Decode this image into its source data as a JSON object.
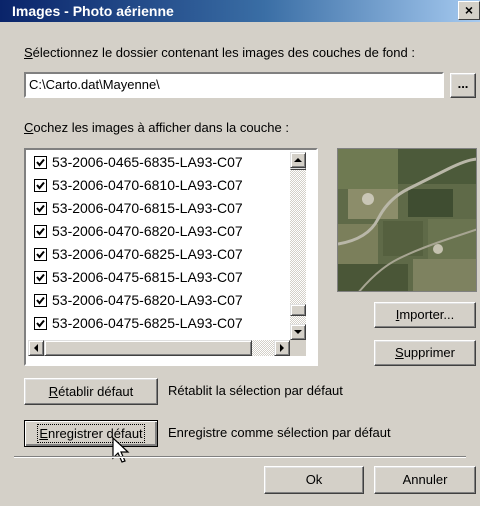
{
  "window": {
    "title": "Images - Photo aérienne",
    "close_glyph": "×"
  },
  "folder": {
    "label_prefix": "S",
    "label_rest": "électionnez le dossier contenant les images des couches de fond :",
    "path_value": "C:\\Carto.dat\\Mayenne\\",
    "browse_label": "..."
  },
  "images": {
    "label_prefix": "C",
    "label_rest": "ochez les images à afficher dans la couche :",
    "items": [
      {
        "name": "53-2006-0465-6835-LA93-C07",
        "checked": true
      },
      {
        "name": "53-2006-0470-6810-LA93-C07",
        "checked": true
      },
      {
        "name": "53-2006-0470-6815-LA93-C07",
        "checked": true
      },
      {
        "name": "53-2006-0470-6820-LA93-C07",
        "checked": true
      },
      {
        "name": "53-2006-0470-6825-LA93-C07",
        "checked": true
      },
      {
        "name": "53-2006-0475-6815-LA93-C07",
        "checked": true
      },
      {
        "name": "53-2006-0475-6820-LA93-C07",
        "checked": true
      },
      {
        "name": "53-2006-0475-6825-LA93-C07",
        "checked": true
      }
    ]
  },
  "buttons": {
    "import_prefix": "I",
    "import_rest": "mporter...",
    "delete_prefix": "S",
    "delete_rest": "upprimer",
    "reset_prefix": "R",
    "reset_rest": "établir défaut",
    "reset_desc": "Rétablit la sélection par défaut",
    "save_prefix": "E",
    "save_rest": "nregistrer défaut",
    "save_desc": "Enregistre comme sélection par défaut",
    "ok_label": "Ok",
    "cancel_label": "Annuler"
  },
  "icons": {
    "checkbox": "checkmark-icon",
    "scroll_up": "arrow-up-icon",
    "scroll_down": "arrow-down-icon",
    "scroll_left": "arrow-left-icon",
    "scroll_right": "arrow-right-icon",
    "cursor": "mouse-pointer-icon"
  },
  "colors": {
    "title_start": "#0a246a",
    "title_end": "#a6caf0",
    "face": "#d4d0c8"
  }
}
